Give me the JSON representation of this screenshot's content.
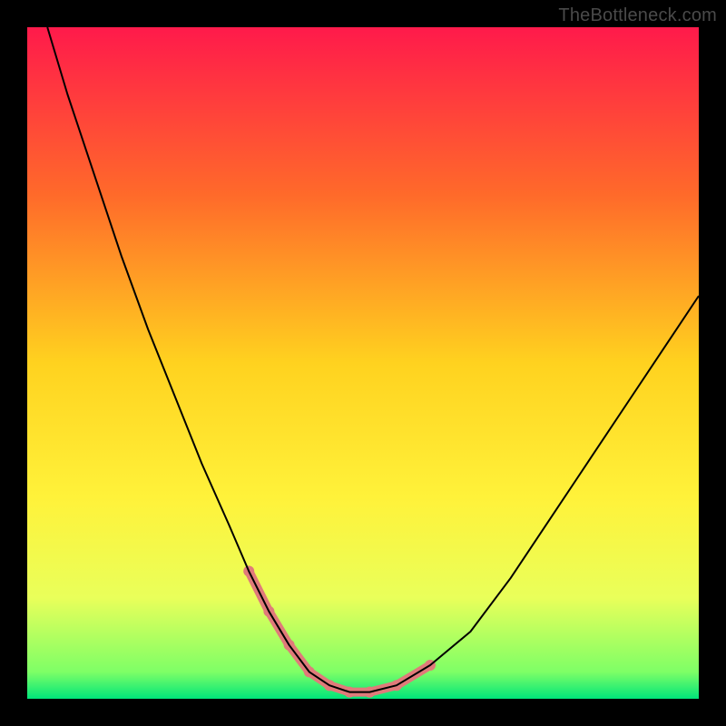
{
  "watermark": "TheBottleneck.com",
  "chart_data": {
    "type": "line",
    "title": "",
    "xlabel": "",
    "ylabel": "",
    "xlim": [
      0,
      100
    ],
    "ylim": [
      0,
      100
    ],
    "grid": false,
    "legend": false,
    "background_gradient": {
      "stops": [
        {
          "pos": 0.0,
          "color": "#ff1a4b"
        },
        {
          "pos": 0.25,
          "color": "#ff6a2a"
        },
        {
          "pos": 0.5,
          "color": "#ffd21f"
        },
        {
          "pos": 0.7,
          "color": "#fff23a"
        },
        {
          "pos": 0.85,
          "color": "#e9ff5a"
        },
        {
          "pos": 0.96,
          "color": "#7eff66"
        },
        {
          "pos": 1.0,
          "color": "#00e57a"
        }
      ]
    },
    "series": [
      {
        "name": "bottleneck-curve",
        "color": "#000000",
        "width": 2,
        "x": [
          3,
          6,
          10,
          14,
          18,
          22,
          26,
          30,
          33,
          36,
          39,
          42,
          45,
          48,
          51,
          55,
          60,
          66,
          72,
          78,
          84,
          90,
          96,
          100
        ],
        "y": [
          100,
          90,
          78,
          66,
          55,
          45,
          35,
          26,
          19,
          13,
          8,
          4,
          2,
          1,
          1,
          2,
          5,
          10,
          18,
          27,
          36,
          45,
          54,
          60
        ]
      },
      {
        "name": "valley-marker-left",
        "color": "#e07a7a",
        "width": 10,
        "linecap": "round",
        "x": [
          33,
          36,
          39,
          42,
          45
        ],
        "y": [
          19,
          13,
          8,
          4,
          2
        ]
      },
      {
        "name": "valley-marker-bottom",
        "color": "#e07a7a",
        "width": 10,
        "linecap": "round",
        "x": [
          45,
          48,
          51
        ],
        "y": [
          2,
          1,
          1
        ]
      },
      {
        "name": "valley-marker-right",
        "color": "#e07a7a",
        "width": 10,
        "linecap": "round",
        "x": [
          51,
          55,
          60
        ],
        "y": [
          1,
          2,
          5
        ]
      }
    ]
  }
}
